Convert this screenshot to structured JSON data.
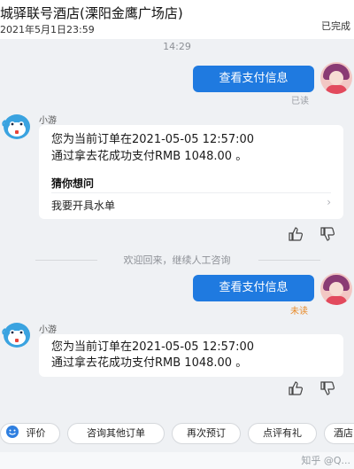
{
  "header": {
    "hotel_name": "城驿联号酒店(溧阳金鹰广场店)",
    "order_time": "2021年5月1日23:59",
    "status": "已完成"
  },
  "conversation": {
    "time_divider": "14:29",
    "first_user_message": {
      "text": "查看支付信息",
      "status": "已读"
    },
    "bot_name": "小游",
    "first_bot_message": {
      "line1": "您为当前订单在2021-05-05 12:57:00",
      "line2": "通过拿去花成功支付RMB 1048.00 。",
      "guess_title": "猜你想问",
      "guess_item": "我要开具水单",
      "guess_arrow": "›"
    },
    "resume_divider": "欢迎回来，继续人工咨询",
    "second_user_message": {
      "text": "查看支付信息",
      "status": "未读"
    },
    "second_bot_message": {
      "line1": "您为当前订单在2021-05-05 12:57:00",
      "line2": "通过拿去花成功支付RMB 1048.00 。"
    }
  },
  "quick_actions": [
    "评价",
    "咨询其他订单",
    "再次预订",
    "点评有礼",
    "酒店"
  ],
  "watermark": "知乎 @Q..."
}
